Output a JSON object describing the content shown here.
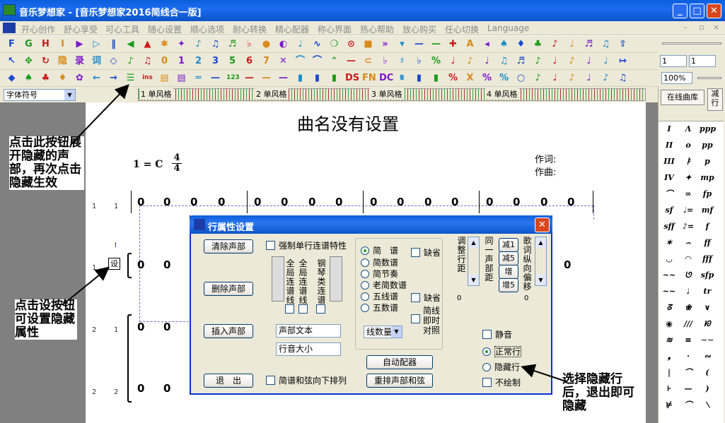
{
  "window": {
    "title": "音乐梦想家 - [音乐梦想家2016简线合一版]",
    "min": "_",
    "max": "□",
    "close": "✕"
  },
  "menu": [
    "开心创作",
    "舒心享受",
    "可心工具",
    "随心设置",
    "顺心选项",
    "耐心转换",
    "精心配器",
    "称心界面",
    "热心帮助",
    "放心购买",
    "任心切换",
    "Language"
  ],
  "toolbar": {
    "row1": [
      "F",
      "G",
      "H",
      "I",
      "▶",
      "▷",
      "‖",
      "◀",
      "▲",
      "✱",
      "✦",
      "♪",
      "♫",
      "♬",
      "♭",
      "●",
      "◐",
      "♩",
      "∿",
      "❍",
      "⊙",
      "■",
      "»",
      "▾",
      "—",
      "—",
      "✚",
      "A",
      "◂",
      "♠",
      "♦",
      "♣",
      "♪",
      "♩",
      "♬",
      "♫",
      "⇧"
    ],
    "row2": [
      "↖",
      "✥",
      "↻",
      "隐",
      "录",
      "词",
      "◇",
      "♪",
      "♫",
      "0",
      "1",
      "2",
      "3",
      "5",
      "6",
      "7",
      "✕",
      "⌒",
      "⌒",
      "⌃",
      "—",
      "⊂",
      "♭",
      "♯",
      "♭",
      "%",
      "♩",
      "♪",
      "♩",
      "♫",
      "♬",
      "♪",
      "♩",
      "♪",
      "♩",
      "♩",
      "↦"
    ],
    "row3": [
      "◆",
      "♠",
      "♣",
      "♦",
      "✿",
      "←",
      "→",
      "☰",
      "ins",
      "▤",
      "▤",
      "═",
      "—",
      "123",
      "—",
      "—",
      "—",
      "▮",
      "▮",
      "▮",
      "DS",
      "FN",
      "DC",
      "𝄋",
      "▮",
      "▮",
      "%",
      "X",
      "%",
      "%",
      "○",
      "♪",
      "♩",
      "♪",
      "♩",
      "♪",
      "♫"
    ],
    "spin1": "1",
    "spin2": "1",
    "zoom": "100%"
  },
  "strip": {
    "font_select": "字体符号",
    "labels": [
      "1  单风格",
      "2  单风格",
      "3  单风格",
      "4  单风格"
    ]
  },
  "score": {
    "title": "曲名没有设置",
    "key": "1 = C",
    "time_top": "4",
    "time_bottom": "4",
    "lyricist": "作词:",
    "composer": "作曲:",
    "row_numbers": [
      "1",
      "1",
      "1",
      "2",
      "1",
      "2",
      "2"
    ],
    "note": "0",
    "settings_button": "设",
    "cursor": "I"
  },
  "right_panel": {
    "online_library": "在线曲库",
    "tab_label": "减行",
    "symbols": [
      "I",
      "Λ",
      "ppp",
      "II",
      "o",
      "pp",
      "III",
      "ㅑ",
      "p",
      "IV",
      "✦",
      "mp",
      "⌒",
      "∞",
      "fp",
      "sf",
      "♩=",
      "mf",
      "sff",
      "♪=",
      "f",
      "✶",
      "⌢",
      "ff",
      "◡",
      "◠",
      "fff",
      "~~",
      "ᘎ",
      "sfp",
      "~~",
      "♩",
      "tr",
      "ᘔ",
      "❀",
      "∨",
      "◉",
      "///",
      "ᘗ",
      "≋",
      "≡",
      "∼∼",
      "❟",
      "·",
      "∾",
      "|",
      "⌒",
      "(",
      "⊦",
      "—",
      ")",
      "⊭",
      "⌒",
      "⟍"
    ]
  },
  "annotations": {
    "a1": "点击此按钮展开隐藏的声部，再次点击隐藏生效",
    "a2": "点击设按钮可设置隐藏属性",
    "a3": "选择隐藏行后，退出即可隐藏"
  },
  "dialog": {
    "title": "行属性设置",
    "close": "✕",
    "btn_clear": "清除声部",
    "btn_delete": "删除声部",
    "btn_insert": "插入声部",
    "btn_exit": "退　出",
    "chk_force": "强制单行连谱特性",
    "chk_jianpu_down": "简谱和弦向下排列",
    "line_labels": [
      "全局连谱线",
      "全局连谱线",
      "钢琴类连谱"
    ],
    "field_voice_text": "声部文本",
    "field_row_size": "行音大小",
    "notation": {
      "jianpu": "简　谱",
      "jianshupu": "简数谱",
      "jianjiezou": "简节奏",
      "laojianshupu": "老简数谱",
      "wuxianpu": "五线谱",
      "wushupu": "五数谱",
      "chk_default": "缺省",
      "chk_default2": "缺省",
      "chk_jianxian": "简线即时对照",
      "line_count": "线数量"
    },
    "adjust_row_spacing": "调整行距",
    "adjust_val": "0",
    "same_voice_spacing": "同一声部距",
    "btn_minus1": "减1",
    "btn_minus5": "减5",
    "btn_plus": "增",
    "btn_plus5": "增5",
    "lyric_offset": "歌词纵向偏移",
    "lyric_val": "0",
    "chk_mute": "静音",
    "radio_normal": "正常行",
    "radio_hidden": "隐藏行",
    "chk_no_draw": "不绘制",
    "btn_auto_arrange": "自动配器",
    "btn_rearrange": "重排声部和弦"
  }
}
